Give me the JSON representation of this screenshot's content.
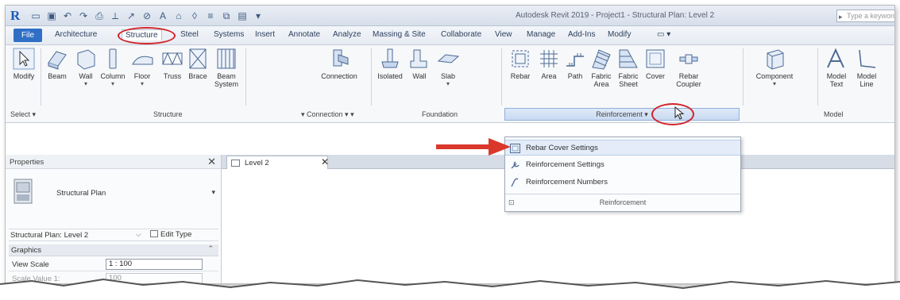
{
  "titlebar": {
    "app_logo": "R",
    "window_title": "Autodesk Revit 2019 - Project1 - Structural Plan: Level 2",
    "search_placeholder": "Type a keyword"
  },
  "tabs": [
    {
      "label": "File"
    },
    {
      "label": "Architecture"
    },
    {
      "label": "Structure"
    },
    {
      "label": "Steel"
    },
    {
      "label": "Systems"
    },
    {
      "label": "Insert"
    },
    {
      "label": "Annotate"
    },
    {
      "label": "Analyze"
    },
    {
      "label": "Massing & Site"
    },
    {
      "label": "Collaborate"
    },
    {
      "label": "View"
    },
    {
      "label": "Manage"
    },
    {
      "label": "Add-Ins"
    },
    {
      "label": "Modify"
    }
  ],
  "ribbon": {
    "tools": [
      {
        "label": "Modify",
        "icon": "cursor-arrow-icon"
      },
      {
        "label": "Beam",
        "icon": "beam-icon"
      },
      {
        "label": "Wall",
        "icon": "wall-icon"
      },
      {
        "label": "Column",
        "icon": "column-icon"
      },
      {
        "label": "Floor",
        "icon": "floor-icon"
      },
      {
        "label": "Truss",
        "icon": "truss-icon"
      },
      {
        "label": "Brace",
        "icon": "brace-icon"
      },
      {
        "label": "Beam\nSystem",
        "icon": "beam-system-icon"
      },
      {
        "label": "Connection",
        "icon": "connection-icon"
      },
      {
        "label": "Isolated",
        "icon": "isolated-foundation-icon"
      },
      {
        "label": "Wall",
        "icon": "wall-foundation-icon"
      },
      {
        "label": "Slab",
        "icon": "slab-icon"
      },
      {
        "label": "Rebar",
        "icon": "rebar-icon"
      },
      {
        "label": "Area",
        "icon": "area-reinforcement-icon"
      },
      {
        "label": "Path",
        "icon": "path-reinforcement-icon"
      },
      {
        "label": "Fabric\nArea",
        "icon": "fabric-area-icon"
      },
      {
        "label": "Fabric\nSheet",
        "icon": "fabric-sheet-icon"
      },
      {
        "label": "Cover",
        "icon": "cover-icon"
      },
      {
        "label": "Rebar\nCoupler",
        "icon": "rebar-coupler-icon"
      },
      {
        "label": "Component",
        "icon": "component-icon"
      },
      {
        "label": "Model\nText",
        "icon": "model-text-icon"
      },
      {
        "label": "Model\nLine",
        "icon": "model-line-icon"
      }
    ],
    "panels": {
      "select": "Select ▾",
      "structure": "Structure",
      "connection": "▾  Connection ▾ ▾",
      "foundation": "Foundation",
      "reinforcement": "Reinforcement ▾",
      "model": "Model"
    }
  },
  "dropdown": {
    "items": [
      {
        "label": "Rebar Cover Settings",
        "icon": "rebar-cover-settings-icon"
      },
      {
        "label": "Reinforcement Settings",
        "icon": "reinforcement-settings-icon"
      },
      {
        "label": "Reinforcement Numbers",
        "icon": "reinforcement-numbers-icon"
      }
    ],
    "footer_label": "Reinforcement"
  },
  "properties": {
    "title": "Properties",
    "type_name": "Structural Plan",
    "instance": "Structural Plan: Level 2",
    "edit_type": "Edit Type",
    "group": "Graphics",
    "rows": [
      {
        "key": "View Scale",
        "value": "1 : 100"
      },
      {
        "key": "Scale Value  1:",
        "value": "100"
      }
    ]
  },
  "view_tab": {
    "label": "Level 2"
  },
  "annotations": {
    "highlight_color": "#d2232a"
  }
}
